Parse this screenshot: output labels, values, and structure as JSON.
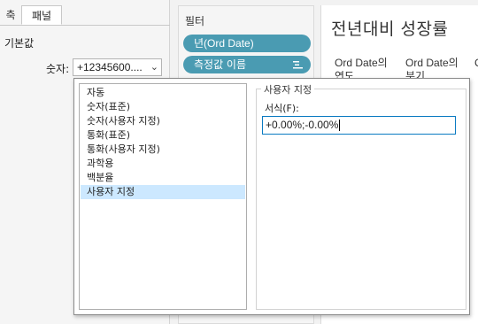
{
  "format_panel": {
    "tabs": [
      {
        "label": "축"
      },
      {
        "label": "패널"
      }
    ],
    "default_label": "기본값",
    "number_label": "숫자:",
    "number_value": "+12345600...."
  },
  "filters": {
    "title": "필터",
    "pills": [
      {
        "label": "년(Ord Date)"
      },
      {
        "label": "측정값 이름"
      }
    ]
  },
  "view": {
    "title": "전년대비 성장률",
    "column_headers": [
      {
        "line1": "Ord Date의",
        "line2": "연도"
      },
      {
        "line1": "Ord Date의",
        "line2": "분기"
      },
      {
        "line1": "C",
        "line2": ""
      }
    ]
  },
  "popup": {
    "format_list": [
      {
        "label": "자동"
      },
      {
        "label": "숫자(표준)"
      },
      {
        "label": "숫자(사용자 지정)"
      },
      {
        "label": "통화(표준)"
      },
      {
        "label": "통화(사용자 지정)"
      },
      {
        "label": "과학용"
      },
      {
        "label": "백분율"
      },
      {
        "label": "사용자 지정"
      }
    ],
    "selected_index": 7,
    "custom_group_title": "사용자 지정",
    "format_caption": "서식(F):",
    "format_value": "+0.00%;-0.00%"
  }
}
